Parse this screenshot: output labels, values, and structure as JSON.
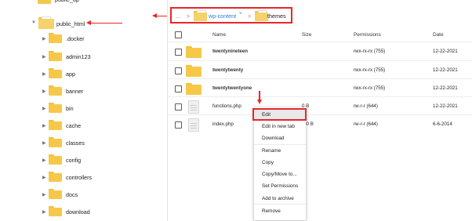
{
  "sidebar": {
    "top_item_label": "public_up",
    "root": {
      "label": "public_html"
    },
    "items": [
      {
        "label": ".docker"
      },
      {
        "label": "admin123"
      },
      {
        "label": "app"
      },
      {
        "label": "banner"
      },
      {
        "label": "bin"
      },
      {
        "label": "cache"
      },
      {
        "label": "classes"
      },
      {
        "label": "config"
      },
      {
        "label": "controllers"
      },
      {
        "label": "docs"
      },
      {
        "label": "download"
      }
    ]
  },
  "breadcrumb": {
    "ellipsis": "...",
    "separator": ">",
    "parent": "wp-content",
    "dropdown_glyph": "˅",
    "current": "themes"
  },
  "table": {
    "headers": {
      "name": "Name",
      "size": "Size",
      "permissions": "Permissions",
      "date": "Date"
    },
    "rows": [
      {
        "name": "twentynineteen",
        "size": "",
        "permissions": "rwx-rx-rx (755)",
        "date": "12-22-2021",
        "type": "folder"
      },
      {
        "name": "twentytwenty",
        "size": "",
        "permissions": "rwx-rx-rx (755)",
        "date": "12-22-2021",
        "type": "folder"
      },
      {
        "name": "twentytwentyone",
        "size": "",
        "permissions": "rwx-rx-rx (755)",
        "date": "12-22-2021",
        "type": "folder"
      },
      {
        "name": "functions.php",
        "size": "0 B",
        "permissions": "rw-r-r (644)",
        "date": "12-22-2021",
        "type": "file"
      },
      {
        "name": "index.php",
        "size": "8.00 B",
        "permissions": "rw-r-r (644)",
        "date": "6-6-2014",
        "type": "file"
      }
    ]
  },
  "context_menu": {
    "items": [
      "Edit",
      "Edit in new tab",
      "Download",
      "Rename",
      "Copy",
      "Copy/Move to...",
      "Set Permissions",
      "Add to archive",
      "Remove"
    ]
  },
  "colors": {
    "annotation_red": "#e8262a",
    "folder_yellow": "#f6c84a",
    "link_blue": "#2a7fd4"
  }
}
